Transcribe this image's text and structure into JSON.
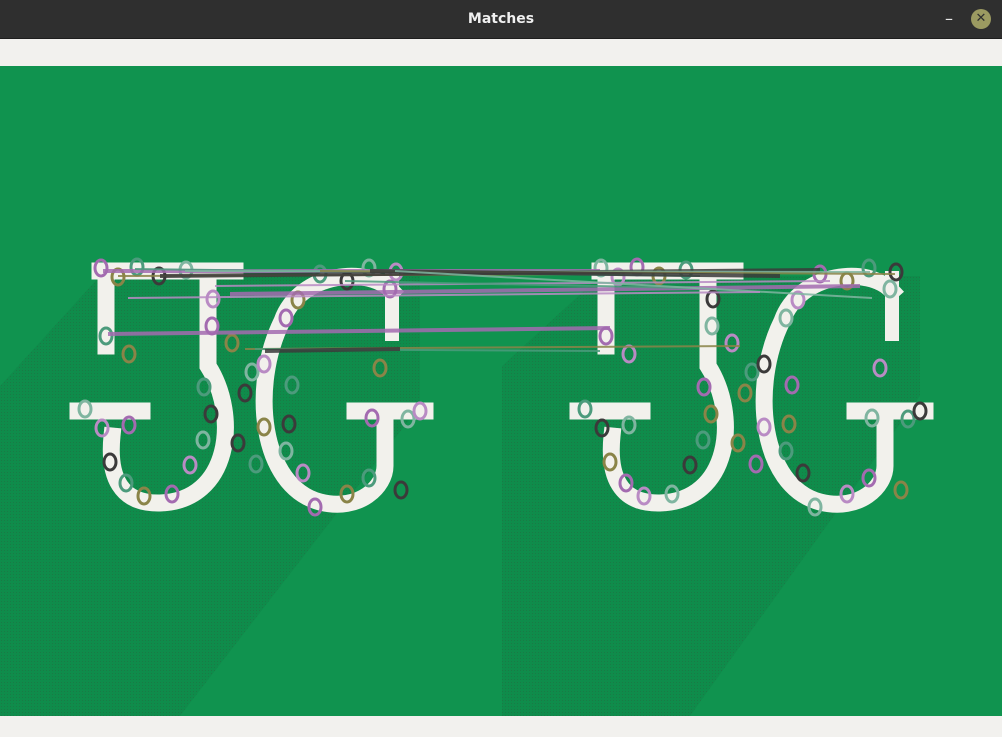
{
  "window": {
    "title": "Matches",
    "minimize_glyph": "–",
    "close_glyph": "✕"
  },
  "icons": {
    "minimize": "minimize-icon",
    "close": "close-icon"
  },
  "colors": {
    "titlebar": "#2f2f2f",
    "canvas_background": "#10934f",
    "glyph_fill": "#f2f1ec",
    "shadow": "#0e854a",
    "close_button": "#9b9a61"
  },
  "image": {
    "left_panel_text": "JG",
    "right_panel_text": "JG",
    "keypoint_palette": [
      "#a36bb0",
      "#8a8448",
      "#4c9b7c",
      "#3b3a3a",
      "#7fb5a0",
      "#b98bc4"
    ]
  }
}
